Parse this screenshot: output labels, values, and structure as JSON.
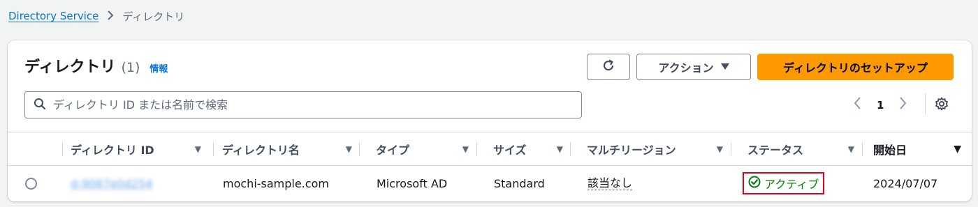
{
  "breadcrumb": {
    "link": "Directory Service",
    "separator": "›",
    "current": "ディレクトリ"
  },
  "header": {
    "title": "ディレクトリ",
    "count": "(1)",
    "info": "情報"
  },
  "toolbar": {
    "actions_label": "アクション",
    "actions_icon": "caret-down-icon",
    "setup_label": "ディレクトリのセットアップ",
    "refresh_icon": "refresh-icon"
  },
  "search": {
    "placeholder": "ディレクトリ ID または名前で検索",
    "value": ""
  },
  "pagination": {
    "prev": "‹",
    "page": "1",
    "next": "›"
  },
  "table": {
    "columns": [
      "ディレクトリ ID",
      "ディレクトリ名",
      "タイプ",
      "サイズ",
      "マルチリージョン",
      "ステータス",
      "開始日"
    ],
    "rows": [
      {
        "directory_id": "d-9067e0d254",
        "name": "mochi-sample.com",
        "type": "Microsoft AD",
        "size": "Standard",
        "multi_region": "該当なし",
        "status": "アクティブ",
        "launch_date": "2024/07/07"
      }
    ]
  },
  "colors": {
    "accent": "#0972d3",
    "primary_button": "#ff9900",
    "status_success": "#037f0c",
    "highlight_box": "#e0001b"
  }
}
